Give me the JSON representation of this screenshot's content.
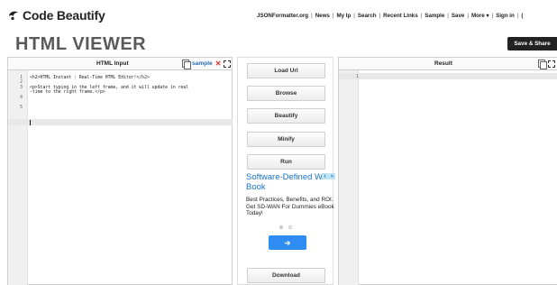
{
  "brand": {
    "logo_text": "Code Beautify"
  },
  "topnav": {
    "items": [
      "JSONFormatter.org",
      "News",
      "My Ip",
      "Search",
      "Recent Links",
      "Sample",
      "Save",
      "More ▾",
      "Sign in",
      "("
    ]
  },
  "page": {
    "title": "HTML VIEWER"
  },
  "save_share_label": "Save & Share",
  "left_panel": {
    "title": "HTML Input",
    "sample_label": "sample",
    "close_label": "✕",
    "line_numbers": [
      "1",
      "2",
      "3",
      "",
      "4",
      "5"
    ],
    "code_lines": [
      "<h2>HTML Instant : Real-Time HTML Editor!</h2>",
      "",
      "<p>Start typing in the left frame, and it will update in real",
      "-time to the right frame.</p>",
      "",
      ""
    ]
  },
  "right_panel": {
    "title": "Result",
    "line_numbers": [
      "1"
    ]
  },
  "actions": {
    "load_url": "Load Url",
    "browse": "Browse",
    "beautify": "Beautify",
    "minify": "Minify",
    "run": "Run",
    "download": "Download"
  },
  "ad": {
    "title": "Software-Defined WAN Book",
    "body": "Best Practices, Benefits, and ROI. Get SD-WAN For Dummies eBook Today!",
    "info": "i",
    "close": "✕",
    "go_arrow": "➔"
  },
  "colors": {
    "accent_link": "#2a6fb5",
    "close_red": "#d9302b",
    "ad_blue": "#2f8cf2",
    "dark_button": "#222222"
  },
  "icons": [
    "code-beautify-logo-icon",
    "copy-icon",
    "close-icon",
    "expand-icon",
    "ad-info-icon",
    "ad-close-icon",
    "arrow-right-icon"
  ]
}
